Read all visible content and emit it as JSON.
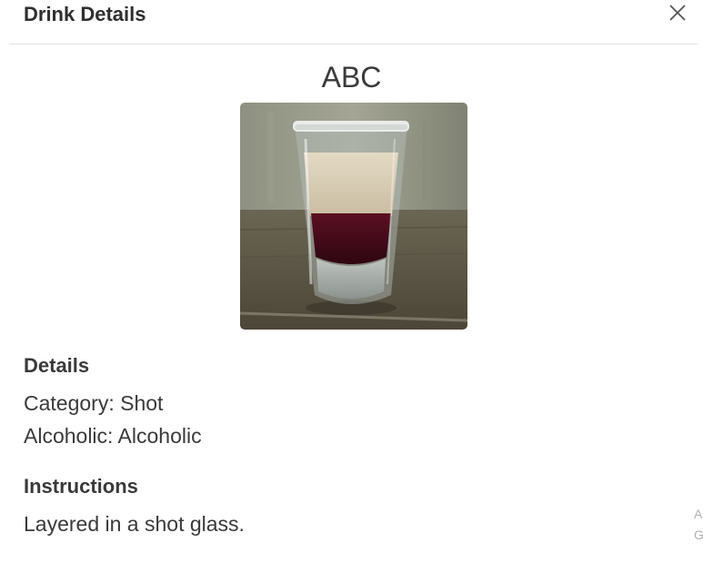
{
  "modal": {
    "title": "Drink Details",
    "close_icon": "close-icon"
  },
  "drink": {
    "name": "ABC",
    "image_icon": "shot-glass-photo"
  },
  "details": {
    "heading": "Details",
    "category_line": "Category: Shot",
    "alcoholic_line": "Alcoholic: Alcoholic"
  },
  "instructions": {
    "heading": "Instructions",
    "text": "Layered in a shot glass."
  },
  "edge_fragments": [
    "A",
    "G"
  ]
}
